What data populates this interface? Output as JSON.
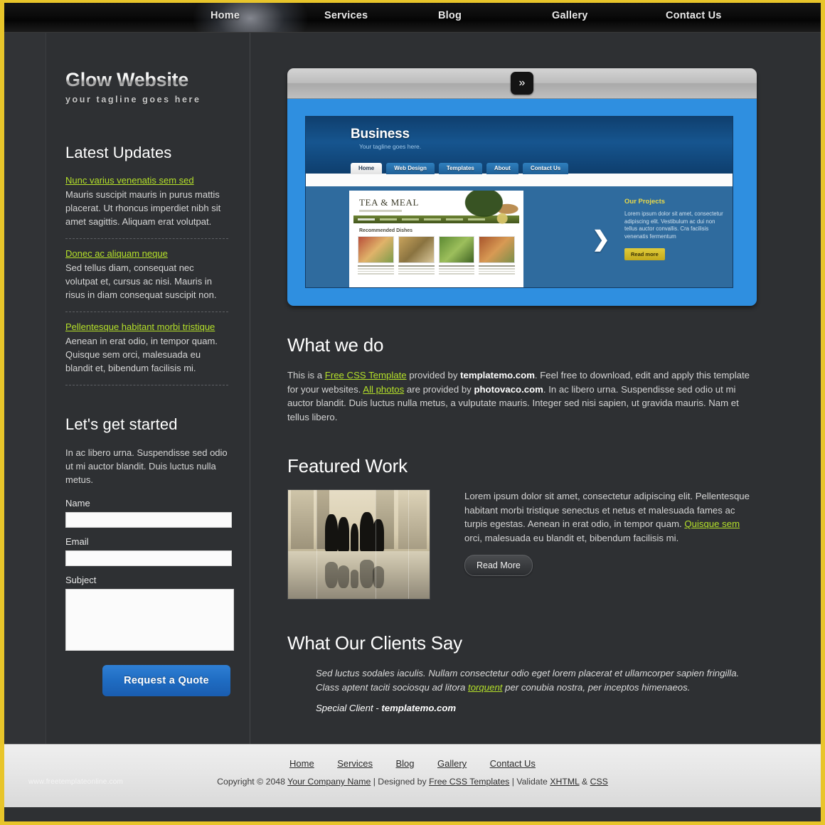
{
  "theme": {
    "border_gold": "#e8c52a",
    "page_bg": "#2e3033",
    "link_green": "#b5e12a",
    "button_blue": "#1f6cc2"
  },
  "topnav": {
    "items": [
      {
        "label": "Home",
        "active": true
      },
      {
        "label": "Services",
        "active": false
      },
      {
        "label": "Blog",
        "active": false
      },
      {
        "label": "Gallery",
        "active": false
      },
      {
        "label": "Contact Us",
        "active": false
      }
    ]
  },
  "sidebar": {
    "logo": "Glow Website",
    "tagline": "your tagline goes here",
    "updates_heading": "Latest Updates",
    "updates": [
      {
        "title": "Nunc varius venenatis sem sed",
        "text": "Mauris suscipit mauris in purus mattis placerat. Ut rhoncus imperdiet nibh sit amet sagittis. Aliquam erat volutpat."
      },
      {
        "title": "Donec ac aliquam neque",
        "text": "Sed tellus diam, consequat nec volutpat et, cursus ac nisi. Mauris in risus in diam consequat suscipit non."
      },
      {
        "title": "Pellentesque habitant morbi tristique",
        "text": "Aenean in erat odio, in tempor quam. Quisque sem orci, malesuada eu blandit et, bibendum facilisis mi."
      }
    ],
    "form": {
      "heading": "Let's get started",
      "intro": "In ac libero urna. Suspendisse sed odio ut mi auctor blandit. Duis luctus nulla metus.",
      "name_label": "Name",
      "name_value": "",
      "email_label": "Email",
      "email_value": "",
      "subject_label": "Subject",
      "subject_value": "",
      "submit_label": "Request a Quote"
    }
  },
  "slider": {
    "next_icon": "»",
    "shot": {
      "title": "Business",
      "tagline": "Your tagline goes here.",
      "tabs": [
        "Home",
        "Web Design",
        "Templates",
        "About",
        "Contact Us"
      ],
      "thumb_title": "TEA & MEAL",
      "thumb_section": "Recommended Dishes",
      "arrow_icon": "❯",
      "panel_title": "Our Projects",
      "panel_text": "Lorem ipsum dolor sit amet, consectetur adipiscing elit. Vestibulum ac dui non tellus auctor convallis. Cra facilisis venenatis fermentum",
      "panel_button": "Read more"
    }
  },
  "main": {
    "what_we_do": {
      "heading": "What we do",
      "part1": "This is a ",
      "link1": "Free CSS Template",
      "part2": " provided by ",
      "bold1": "templatemo.com",
      "part3": ". Feel free to download, edit and apply this template for your websites. ",
      "link2": "All photos",
      "part4": " are provided by ",
      "bold2": "photovaco.com",
      "part5": ". In ac libero urna. Suspendisse sed odio ut mi auctor blandit. Duis luctus nulla metus, a vulputate mauris. Integer sed nisi sapien, ut gravida mauris. Nam et tellus libero."
    },
    "featured_work": {
      "heading": "Featured Work",
      "part1": "Lorem ipsum dolor sit amet, consectetur adipiscing elit. Pellentesque habitant morbi tristique senectus et netus et malesuada fames ac turpis egestas. Aenean in erat odio, in tempor quam. ",
      "link": "Quisque sem",
      "part2": " orci, malesuada eu blandit et, bibendum facilisis mi.",
      "button": "Read More"
    },
    "testimonial": {
      "heading": "What Our Clients Say",
      "part1": "Sed luctus sodales iaculis. Nullam consectetur odio eget lorem placerat et ullamcorper sapien fringilla. Class aptent taciti sociosqu ad litora ",
      "link": "torquent",
      "part2": " per conubia nostra, per inceptos himenaeos.",
      "author_prefix": "Special Client - ",
      "author_name": "templatemo.com"
    }
  },
  "footer": {
    "links": [
      "Home",
      "Services",
      "Blog",
      "Gallery",
      "Contact Us"
    ],
    "copyright_prefix": "Copyright © 2048 ",
    "company": "Your Company Name",
    "designed_by_prefix": " | Designed by ",
    "designer": "Free CSS Templates",
    "validate_prefix": " | Validate ",
    "xhtml": "XHTML",
    "amp": " & ",
    "css": "CSS",
    "watermark": "www.freetemplateonline.com"
  }
}
